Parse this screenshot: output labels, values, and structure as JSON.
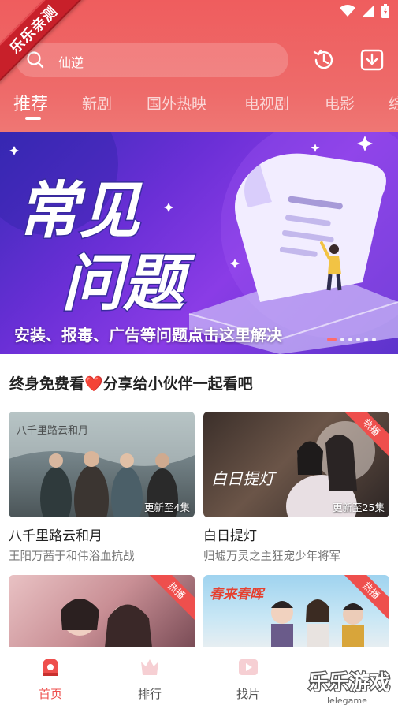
{
  "ribbon": "乐乐亲测",
  "search": {
    "text": "仙逆"
  },
  "tabs": [
    {
      "label": "推荐"
    },
    {
      "label": "新剧"
    },
    {
      "label": "国外热映"
    },
    {
      "label": "电视剧"
    },
    {
      "label": "电影"
    },
    {
      "label": "综"
    }
  ],
  "banner": {
    "heading_line1": "常见",
    "heading_line2": "问题",
    "caption": "安装、报毒、广告等问题点击这里解决",
    "slide_count": 6,
    "active_slide": 1
  },
  "section": {
    "title": "终身免费看❤️分享给小伙伴一起看吧"
  },
  "cards": [
    {
      "title": "八千里路云和月",
      "subtitle": "王阳万茜于和伟浴血抗战",
      "update": "更新至4集",
      "poster_text": "八千里路云和月",
      "hot": ""
    },
    {
      "title": "白日提灯",
      "subtitle": "归墟万灵之主狂宠少年将军",
      "update": "更新至25集",
      "poster_text": "白日提灯",
      "hot": "热播"
    },
    {
      "title": "",
      "subtitle": "",
      "update": "",
      "poster_text": "",
      "hot": "热播"
    },
    {
      "title": "",
      "subtitle": "",
      "update": "",
      "poster_text": "春来春晖",
      "hot": "热播"
    }
  ],
  "nav": [
    {
      "label": "首页"
    },
    {
      "label": "排行"
    },
    {
      "label": "找片"
    }
  ],
  "watermark": {
    "text": "乐乐游戏",
    "sub": "lelegame"
  },
  "colors": {
    "accent": "#ee4f4d",
    "header": "#ef5d5e",
    "banner_purple": "#6a2fd6"
  }
}
